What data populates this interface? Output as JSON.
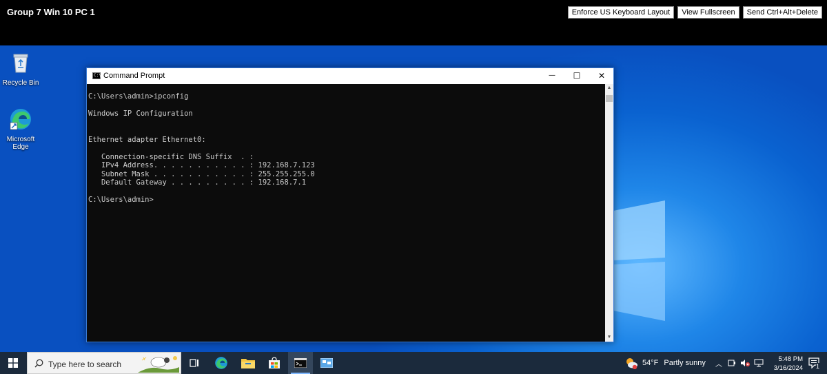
{
  "vm": {
    "title": "Group 7 Win 10 PC 1",
    "buttons": [
      "Enforce US Keyboard Layout",
      "View Fullscreen",
      "Send Ctrl+Alt+Delete"
    ]
  },
  "desktop": {
    "icons": [
      {
        "label": "Recycle Bin",
        "icon": "recycle-bin-icon"
      },
      {
        "label": "Microsoft Edge",
        "icon": "edge-icon"
      }
    ]
  },
  "cmd": {
    "title": "Command Prompt",
    "controls": {
      "minimize": "—",
      "maximize": "☐",
      "close": "✕"
    },
    "output": "C:\\Users\\admin>ipconfig\n\nWindows IP Configuration\n\n\nEthernet adapter Ethernet0:\n\n   Connection-specific DNS Suffix  . :\n   IPv4 Address. . . . . . . . . . . : 192.168.7.123\n   Subnet Mask . . . . . . . . . . . : 255.255.255.0\n   Default Gateway . . . . . . . . . : 192.168.7.1\n\nC:\\Users\\admin>"
  },
  "taskbar": {
    "search_placeholder": "Type here to search",
    "weather_temp": "54°F",
    "weather_text": "Partly sunny",
    "time": "5:48 PM",
    "date": "3/16/2024",
    "notification_count": "1"
  },
  "colors": {
    "accent": "#0a62d0",
    "taskbar": "#1b2a3c",
    "console_bg": "#0c0c0c",
    "console_text": "#cccccc"
  }
}
